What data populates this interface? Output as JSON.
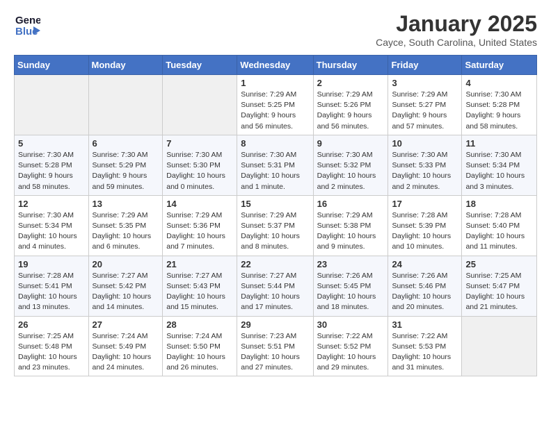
{
  "header": {
    "logo_line1": "General",
    "logo_line2": "Blue",
    "month_title": "January 2025",
    "location": "Cayce, South Carolina, United States"
  },
  "weekdays": [
    "Sunday",
    "Monday",
    "Tuesday",
    "Wednesday",
    "Thursday",
    "Friday",
    "Saturday"
  ],
  "weeks": [
    [
      {
        "day": "",
        "detail": ""
      },
      {
        "day": "",
        "detail": ""
      },
      {
        "day": "",
        "detail": ""
      },
      {
        "day": "1",
        "detail": "Sunrise: 7:29 AM\nSunset: 5:25 PM\nDaylight: 9 hours\nand 56 minutes."
      },
      {
        "day": "2",
        "detail": "Sunrise: 7:29 AM\nSunset: 5:26 PM\nDaylight: 9 hours\nand 56 minutes."
      },
      {
        "day": "3",
        "detail": "Sunrise: 7:29 AM\nSunset: 5:27 PM\nDaylight: 9 hours\nand 57 minutes."
      },
      {
        "day": "4",
        "detail": "Sunrise: 7:30 AM\nSunset: 5:28 PM\nDaylight: 9 hours\nand 58 minutes."
      }
    ],
    [
      {
        "day": "5",
        "detail": "Sunrise: 7:30 AM\nSunset: 5:28 PM\nDaylight: 9 hours\nand 58 minutes."
      },
      {
        "day": "6",
        "detail": "Sunrise: 7:30 AM\nSunset: 5:29 PM\nDaylight: 9 hours\nand 59 minutes."
      },
      {
        "day": "7",
        "detail": "Sunrise: 7:30 AM\nSunset: 5:30 PM\nDaylight: 10 hours\nand 0 minutes."
      },
      {
        "day": "8",
        "detail": "Sunrise: 7:30 AM\nSunset: 5:31 PM\nDaylight: 10 hours\nand 1 minute."
      },
      {
        "day": "9",
        "detail": "Sunrise: 7:30 AM\nSunset: 5:32 PM\nDaylight: 10 hours\nand 2 minutes."
      },
      {
        "day": "10",
        "detail": "Sunrise: 7:30 AM\nSunset: 5:33 PM\nDaylight: 10 hours\nand 2 minutes."
      },
      {
        "day": "11",
        "detail": "Sunrise: 7:30 AM\nSunset: 5:34 PM\nDaylight: 10 hours\nand 3 minutes."
      }
    ],
    [
      {
        "day": "12",
        "detail": "Sunrise: 7:30 AM\nSunset: 5:34 PM\nDaylight: 10 hours\nand 4 minutes."
      },
      {
        "day": "13",
        "detail": "Sunrise: 7:29 AM\nSunset: 5:35 PM\nDaylight: 10 hours\nand 6 minutes."
      },
      {
        "day": "14",
        "detail": "Sunrise: 7:29 AM\nSunset: 5:36 PM\nDaylight: 10 hours\nand 7 minutes."
      },
      {
        "day": "15",
        "detail": "Sunrise: 7:29 AM\nSunset: 5:37 PM\nDaylight: 10 hours\nand 8 minutes."
      },
      {
        "day": "16",
        "detail": "Sunrise: 7:29 AM\nSunset: 5:38 PM\nDaylight: 10 hours\nand 9 minutes."
      },
      {
        "day": "17",
        "detail": "Sunrise: 7:28 AM\nSunset: 5:39 PM\nDaylight: 10 hours\nand 10 minutes."
      },
      {
        "day": "18",
        "detail": "Sunrise: 7:28 AM\nSunset: 5:40 PM\nDaylight: 10 hours\nand 11 minutes."
      }
    ],
    [
      {
        "day": "19",
        "detail": "Sunrise: 7:28 AM\nSunset: 5:41 PM\nDaylight: 10 hours\nand 13 minutes."
      },
      {
        "day": "20",
        "detail": "Sunrise: 7:27 AM\nSunset: 5:42 PM\nDaylight: 10 hours\nand 14 minutes."
      },
      {
        "day": "21",
        "detail": "Sunrise: 7:27 AM\nSunset: 5:43 PM\nDaylight: 10 hours\nand 15 minutes."
      },
      {
        "day": "22",
        "detail": "Sunrise: 7:27 AM\nSunset: 5:44 PM\nDaylight: 10 hours\nand 17 minutes."
      },
      {
        "day": "23",
        "detail": "Sunrise: 7:26 AM\nSunset: 5:45 PM\nDaylight: 10 hours\nand 18 minutes."
      },
      {
        "day": "24",
        "detail": "Sunrise: 7:26 AM\nSunset: 5:46 PM\nDaylight: 10 hours\nand 20 minutes."
      },
      {
        "day": "25",
        "detail": "Sunrise: 7:25 AM\nSunset: 5:47 PM\nDaylight: 10 hours\nand 21 minutes."
      }
    ],
    [
      {
        "day": "26",
        "detail": "Sunrise: 7:25 AM\nSunset: 5:48 PM\nDaylight: 10 hours\nand 23 minutes."
      },
      {
        "day": "27",
        "detail": "Sunrise: 7:24 AM\nSunset: 5:49 PM\nDaylight: 10 hours\nand 24 minutes."
      },
      {
        "day": "28",
        "detail": "Sunrise: 7:24 AM\nSunset: 5:50 PM\nDaylight: 10 hours\nand 26 minutes."
      },
      {
        "day": "29",
        "detail": "Sunrise: 7:23 AM\nSunset: 5:51 PM\nDaylight: 10 hours\nand 27 minutes."
      },
      {
        "day": "30",
        "detail": "Sunrise: 7:22 AM\nSunset: 5:52 PM\nDaylight: 10 hours\nand 29 minutes."
      },
      {
        "day": "31",
        "detail": "Sunrise: 7:22 AM\nSunset: 5:53 PM\nDaylight: 10 hours\nand 31 minutes."
      },
      {
        "day": "",
        "detail": ""
      }
    ]
  ]
}
